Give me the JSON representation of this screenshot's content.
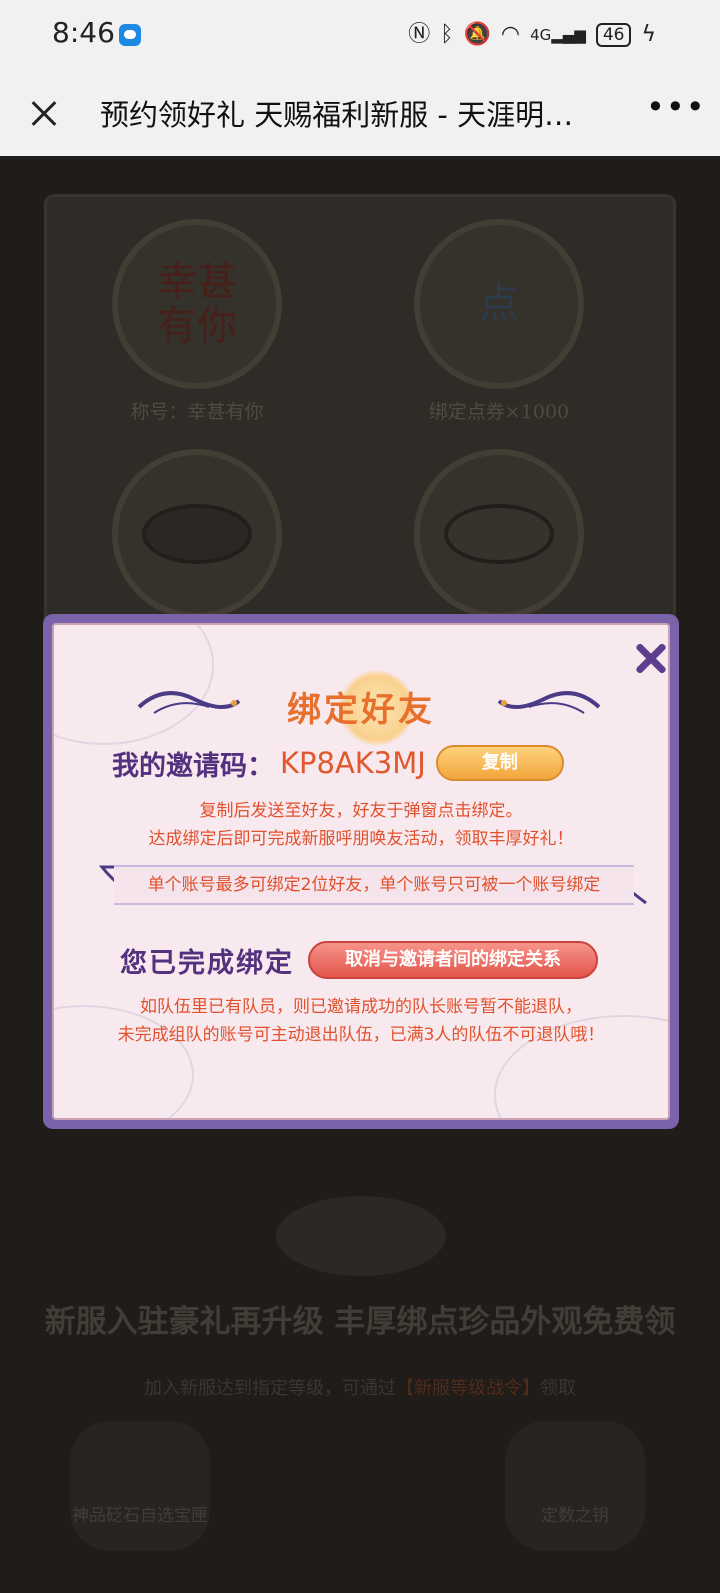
{
  "status_bar": {
    "time": "8:46",
    "network": "4G",
    "battery": "46",
    "icons": [
      "nfc-icon",
      "bluetooth-icon",
      "mute-icon",
      "wifi-icon",
      "signal-icon",
      "battery-icon",
      "charging-icon"
    ]
  },
  "nav": {
    "title": "预约领好礼 天赐福利新服 - 天涯明…",
    "more": "•••"
  },
  "background": {
    "rewards": [
      {
        "glyph": "幸甚\n有你",
        "label": "称号：幸甚有你"
      },
      {
        "glyph": "点",
        "label": "绑定点券×1000"
      }
    ],
    "heading": "新服入驻豪礼再升级 丰厚绑点珍品外观免费领",
    "sub_prefix": "加入新服达到指定等级，可通过",
    "sub_highlight": "【新服等级战令】",
    "sub_suffix": "领取",
    "items": [
      "神品砭石自选宝匣",
      "定数之钥"
    ]
  },
  "modal": {
    "title": "绑定好友",
    "code_label": "我的邀请码：",
    "code_value": "KP8AK3MJ",
    "copy_label": "复制",
    "desc_line1": "复制后发送至好友，好友于弹窗点击绑定。",
    "desc_line2": "达成绑定后即可完成新服呼朋唤友活动，领取丰厚好礼！",
    "limit_text": "单个账号最多可绑定2位好友，单个账号只可被一个账号绑定",
    "bound_label": "您已完成绑定",
    "unbind_label": "取消与邀请者间的绑定关系",
    "team_line1": "如队伍里已有队员，则已邀请成功的队长账号暂不能退队，",
    "team_line2": "未完成组队的账号可主动退出队伍，已满3人的队伍不可退队哦！"
  },
  "colors": {
    "modal_border": "#7a63a8",
    "modal_bg": "#f8e9ef",
    "accent_orange": "#e7702d",
    "text_red": "#e2512d",
    "label_purple": "#52327f"
  }
}
